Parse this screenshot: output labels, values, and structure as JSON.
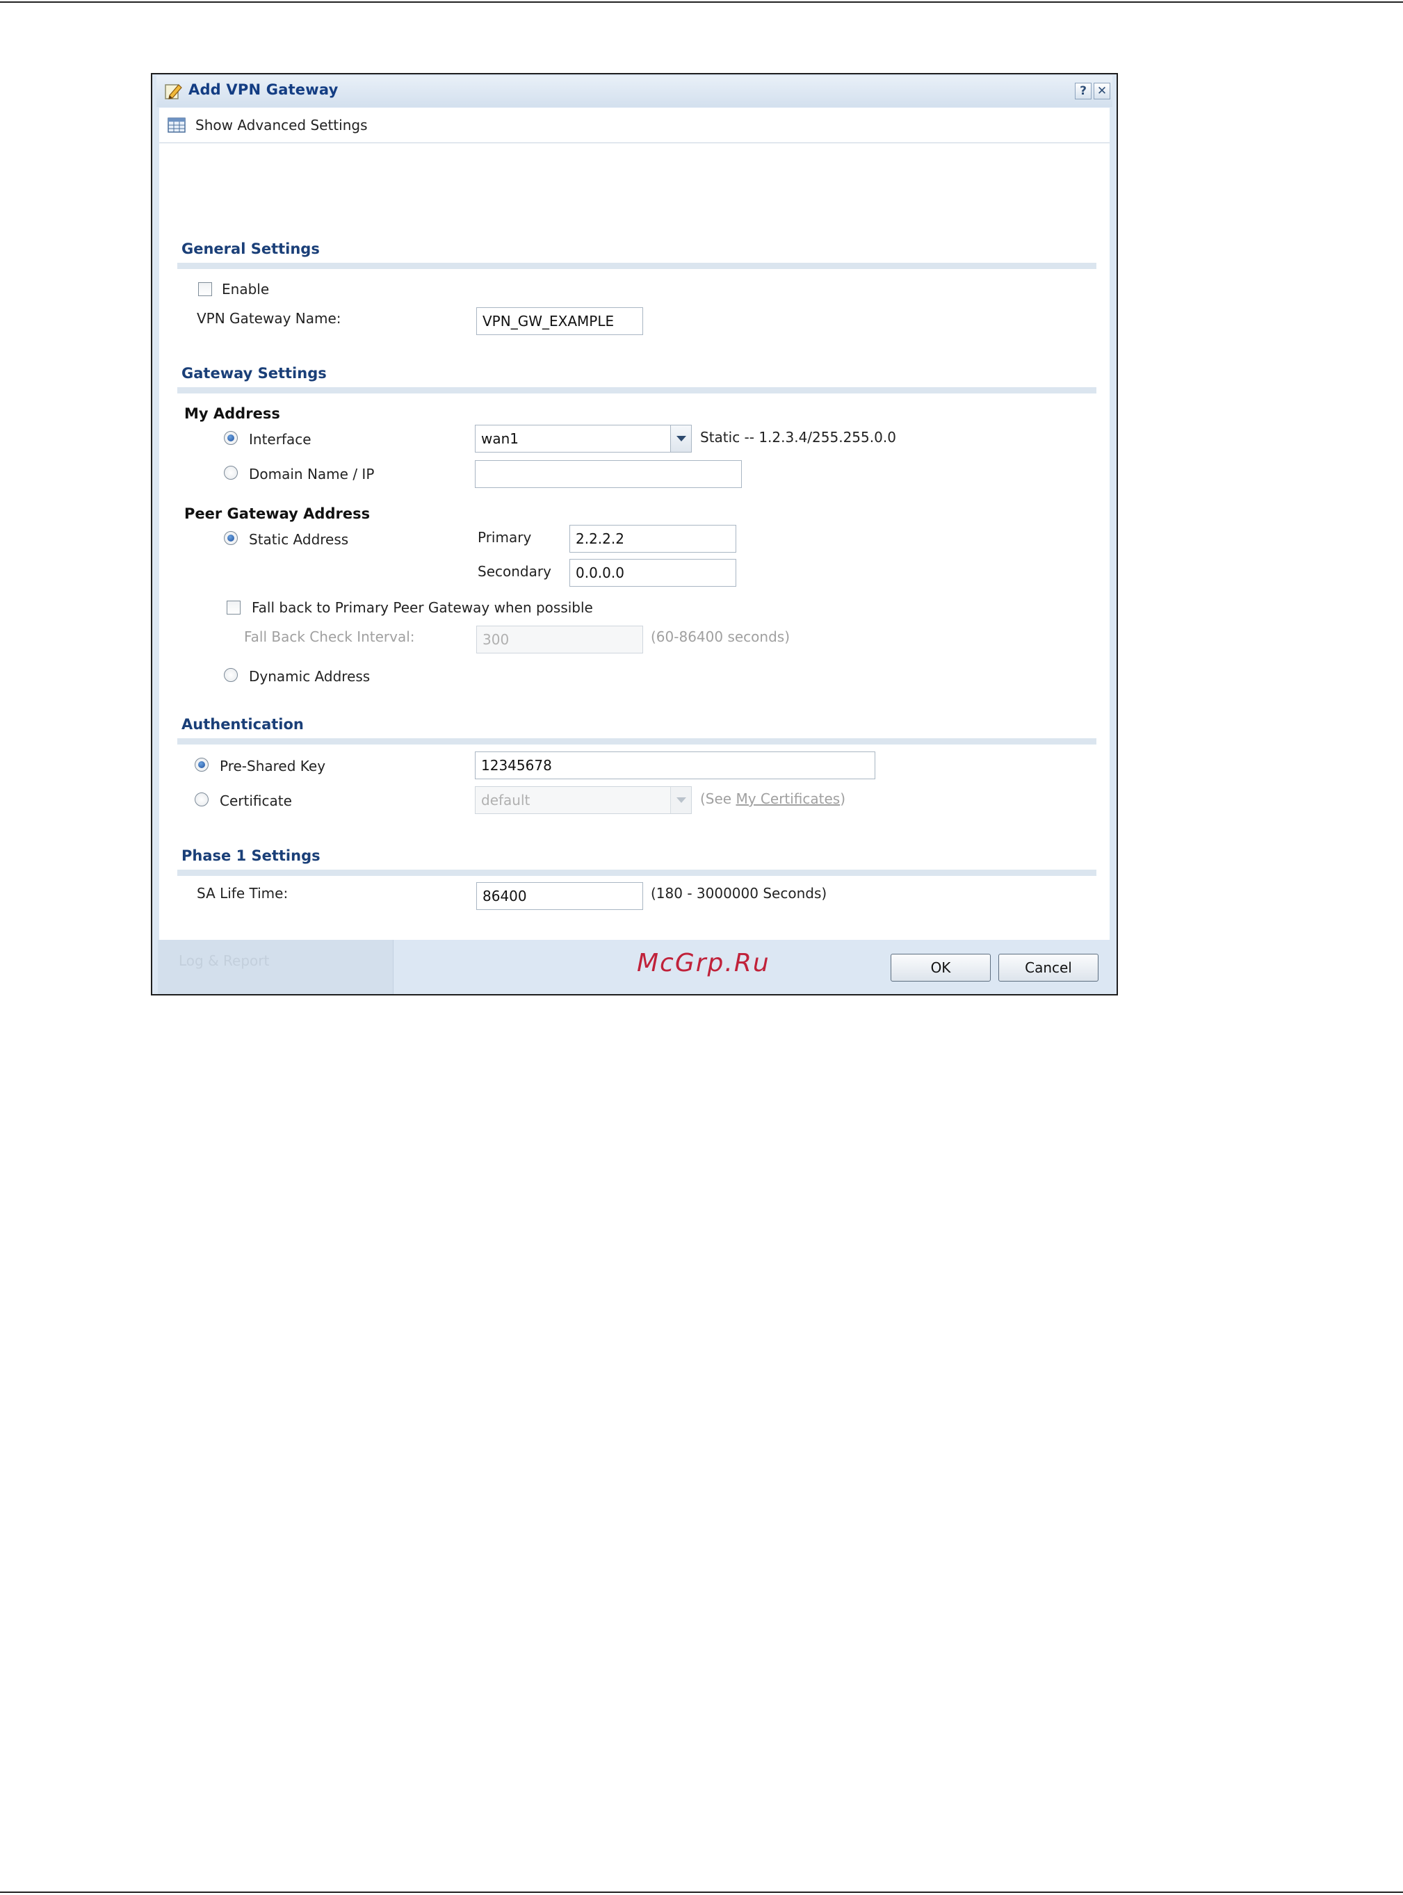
{
  "dialog": {
    "title": "Add VPN Gateway",
    "help_label": "?",
    "close_label": "✕",
    "toolbar_label": "Show Advanced Settings"
  },
  "general": {
    "title": "General Settings",
    "enable_label": "Enable",
    "enable_checked": false,
    "name_label": "VPN Gateway Name:",
    "name_value": "VPN_GW_EXAMPLE"
  },
  "gateway": {
    "title": "Gateway Settings",
    "my_address": {
      "title": "My Address",
      "interface_label": "Interface",
      "interface_selected": true,
      "interface_value": "wan1",
      "interface_info": "Static -- 1.2.3.4/255.255.0.0",
      "domain_label": "Domain Name / IP",
      "domain_value": ""
    },
    "peer": {
      "title": "Peer Gateway Address",
      "static_label": "Static Address",
      "static_selected": true,
      "primary_label": "Primary",
      "primary_value": "2.2.2.2",
      "secondary_label": "Secondary",
      "secondary_value": "0.0.0.0",
      "fallback_label": "Fall back to Primary Peer Gateway when possible",
      "fallback_checked": false,
      "interval_label": "Fall Back Check Interval:",
      "interval_value": "300",
      "interval_hint": "(60-86400 seconds)",
      "dynamic_label": "Dynamic Address"
    }
  },
  "auth": {
    "title": "Authentication",
    "psk_label": "Pre-Shared Key",
    "psk_selected": true,
    "psk_value": "12345678",
    "cert_label": "Certificate",
    "cert_value": "default",
    "cert_hint_prefix": "(See ",
    "cert_hint_link": "My Certificates",
    "cert_hint_suffix": ")"
  },
  "phase1": {
    "title": "Phase 1 Settings",
    "sa_label": "SA Life Time:",
    "sa_value": "86400",
    "sa_hint": "(180 - 3000000 Seconds)"
  },
  "footer": {
    "ghost_text": "Log & Report",
    "watermark": "McGrp.Ru",
    "ok_label": "OK",
    "cancel_label": "Cancel"
  },
  "colors": {
    "section_title": "#1a3f78",
    "dialog_frame": "#dce7f3",
    "watermark": "#c0223a"
  }
}
